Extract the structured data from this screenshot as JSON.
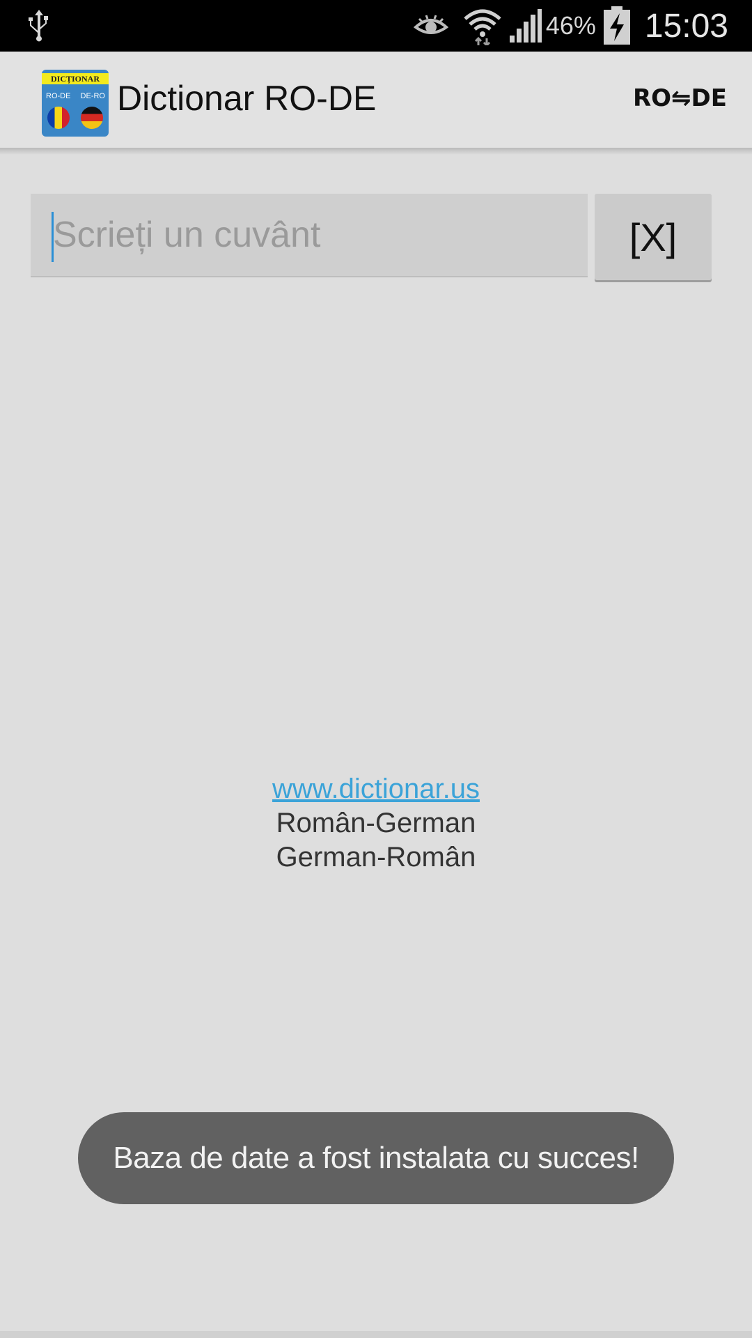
{
  "status_bar": {
    "battery_percent": "46%",
    "time": "15:03",
    "icons": [
      "usb-icon",
      "eye-icon",
      "wifi-icon",
      "signal-icon",
      "battery-charging-icon"
    ]
  },
  "action_bar": {
    "title": "Dictionar RO-DE",
    "app_icon": {
      "banner": "DICȚIONAR",
      "left_label": "RO-DE",
      "right_label": "DE-RO"
    },
    "lang_toggle": "RO⇋DE"
  },
  "search": {
    "placeholder": "Scrieți un cuvânt",
    "value": "",
    "clear_label": "[X]"
  },
  "info": {
    "link": "www.dictionar.us",
    "line1": "Român-German",
    "line2": "German-Român"
  },
  "toast": {
    "message": "Baza de date a fost instalata cu succes!"
  },
  "colors": {
    "background": "#dedede",
    "link": "#3ba3d8",
    "caret": "#2a8fd6",
    "toast_bg": "#616161"
  }
}
